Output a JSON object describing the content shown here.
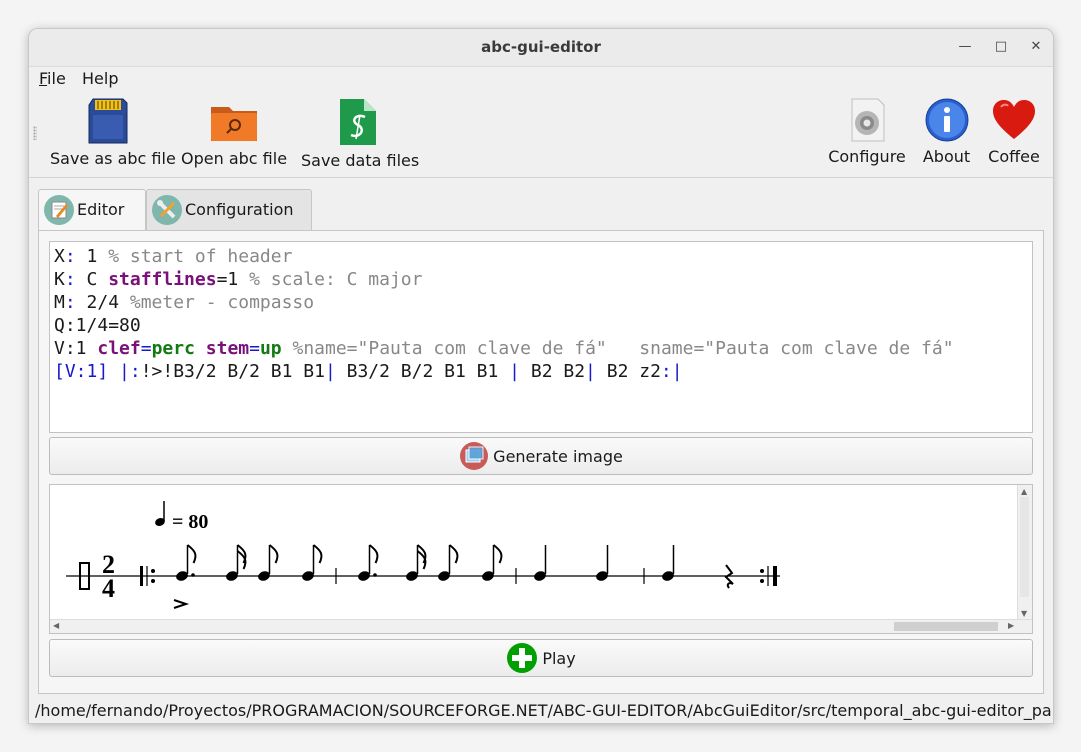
{
  "window": {
    "title": "abc-gui-editor"
  },
  "menu": {
    "file": "File",
    "file_rest": "ile",
    "help": "Help"
  },
  "toolbar": {
    "save_abc": "Save as abc file",
    "open_abc": "Open abc file",
    "save_data": "Save data files",
    "configure": "Configure",
    "about": "About",
    "coffee": "Coffee"
  },
  "tabs": {
    "editor": "Editor",
    "configuration": "Configuration"
  },
  "editor": {
    "lines": [
      "X: 1 % start of header",
      "K: C stafflines=1 % scale: C major",
      "M: 2/4 %meter - compasso",
      "Q:1/4=80",
      "V:1 clef=perc stem=up %name=\"Pauta com clave de fá\"   sname=\"Pauta com clave de fá\"",
      "[V:1] |:!>!B3/2 B/2 B1 B1| B3/2 B/2 B1 B1 | B2 B2| B2 z2:|"
    ],
    "seg": {
      "l1a": "X",
      "l1b": ":",
      "l1c": " 1 ",
      "l1d": "% start of header",
      "l2a": "K",
      "l2b": ":",
      "l2c": " C ",
      "l2d": "stafflines",
      "l2e": "=1 ",
      "l2f": "% scale: C major",
      "l3a": "M",
      "l3b": ":",
      "l3c": " 2/4 ",
      "l3d": "%meter - compasso",
      "l4a": "Q",
      "l4b": ":1/4=80",
      "l5a": "V",
      "l5b": ":1 ",
      "l5c": "clef",
      "l5d": "=",
      "l5e": "perc",
      "l5f": " ",
      "l5g": "stem",
      "l5h": "=",
      "l5i": "up",
      "l5j": " %name=\"Pauta com clave de fá\"   sname=\"Pauta com clave de fá\"",
      "l6a": "[V:1] |:",
      "l6b": "!>!",
      "l6c": "B3/2 B/2 B1 B1",
      "l6d": "|",
      "l6e": " B3/2 B/2 B1 B1 ",
      "l6f": "|",
      "l6g": " B2 B2",
      "l6h": "|",
      "l6i": " B2 z2",
      "l6j": ":|"
    }
  },
  "buttons": {
    "generate": "Generate image",
    "play": "Play"
  },
  "score": {
    "tempo_text": "= 80",
    "time_top": "2",
    "time_bottom": "4"
  },
  "status": {
    "path": "/home/fernando/Proyectos/PROGRAMACION/SOURCEFORGE.NET/ABC-GUI-EDITOR/AbcGuiEditor/src/temporal_abc-gui-editor_pa"
  },
  "colors": {
    "keyword_blue": "#1818cc",
    "keyword_purple": "#7a117a",
    "keyword_green": "#117a11",
    "comment_gray": "#888888",
    "play_green": "#00a000"
  }
}
